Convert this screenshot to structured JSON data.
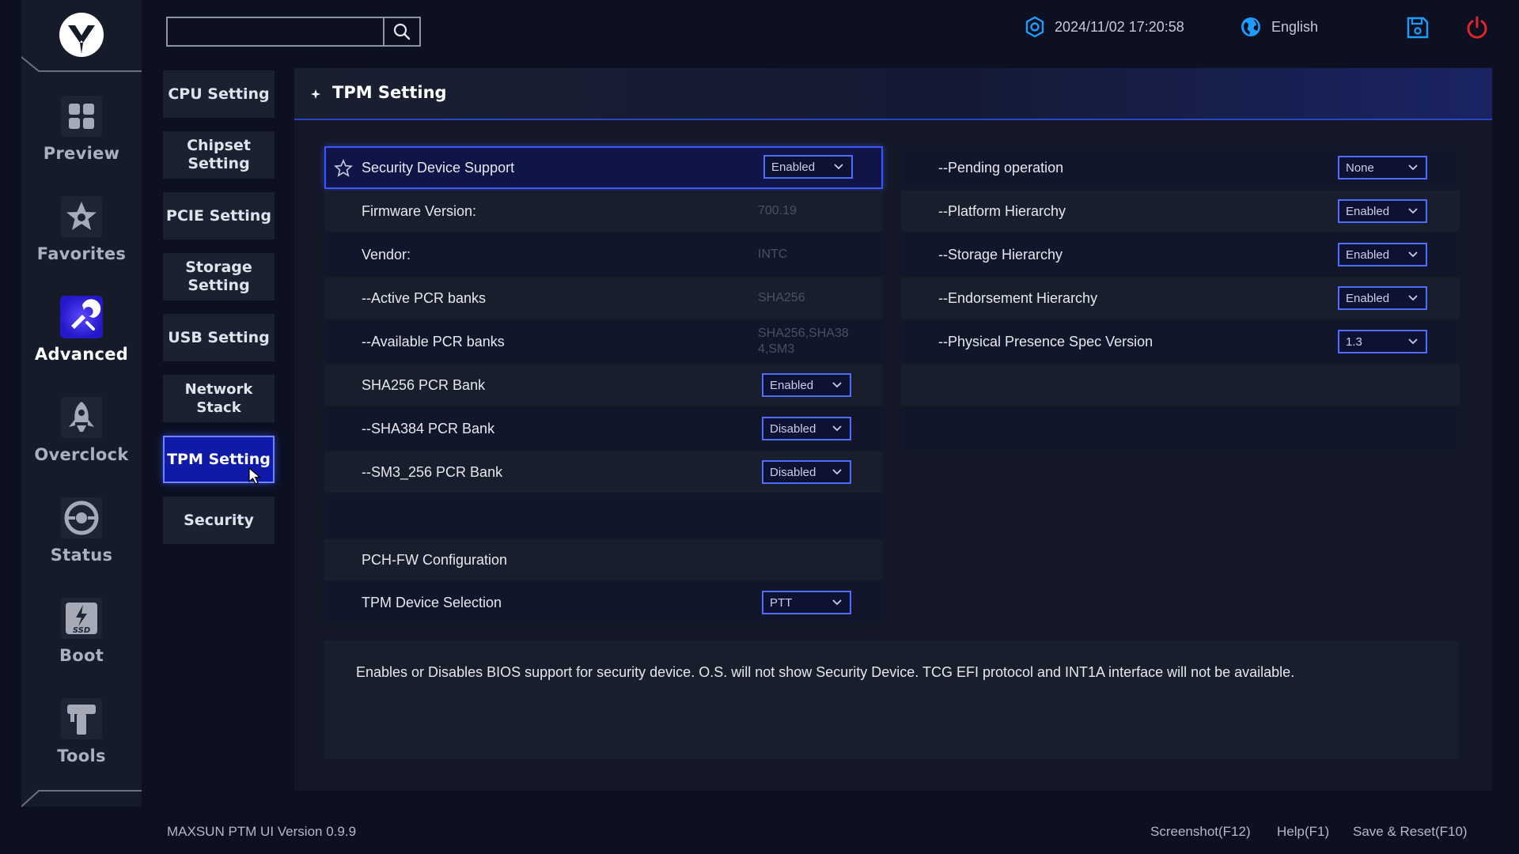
{
  "topbar": {
    "search_placeholder": "",
    "datetime": "2024/11/02 17:20:58",
    "language": "English"
  },
  "mainnav": [
    {
      "label": "Preview",
      "icon": "grid-icon"
    },
    {
      "label": "Favorites",
      "icon": "star-icon"
    },
    {
      "label": "Advanced",
      "icon": "advanced-icon",
      "active": true
    },
    {
      "label": "Overclock",
      "icon": "rocket-icon"
    },
    {
      "label": "Status",
      "icon": "status-icon"
    },
    {
      "label": "Boot",
      "icon": "ssd-icon"
    },
    {
      "label": "Tools",
      "icon": "tools-icon"
    }
  ],
  "subnav": [
    {
      "label": "CPU Setting"
    },
    {
      "label": "Chipset Setting"
    },
    {
      "label": "PCIE Setting"
    },
    {
      "label": "Storage Setting"
    },
    {
      "label": "USB Setting"
    },
    {
      "label": "Network Stack"
    },
    {
      "label": "TPM Setting",
      "active": true
    },
    {
      "label": "Security"
    }
  ],
  "panel": {
    "title": "TPM Setting",
    "left_rows": [
      {
        "label": "Security Device Support",
        "dropdown": "Enabled"
      },
      {
        "label": "Firmware Version:",
        "value": "700.19"
      },
      {
        "label": "Vendor:",
        "value": "INTC"
      },
      {
        "label": "--Active PCR banks",
        "value": "SHA256"
      },
      {
        "label": "--Available PCR banks",
        "value": "SHA256,SHA384,SM3"
      },
      {
        "label": "SHA256 PCR Bank",
        "dropdown": "Enabled"
      },
      {
        "label": "--SHA384 PCR Bank",
        "dropdown": "Disabled"
      },
      {
        "label": "--SM3_256 PCR Bank",
        "dropdown": "Disabled"
      },
      {
        "label": "PCH-FW Configuration"
      },
      {
        "label": "TPM Device Selection",
        "dropdown": "PTT"
      }
    ],
    "right_rows": [
      {
        "label": "--Pending operation",
        "dropdown": "None"
      },
      {
        "label": "--Platform Hierarchy",
        "dropdown": "Enabled"
      },
      {
        "label": "--Storage Hierarchy",
        "dropdown": "Enabled"
      },
      {
        "label": "--Endorsement Hierarchy",
        "dropdown": "Enabled"
      },
      {
        "label": "--Physical Presence Spec Version",
        "dropdown": "1.3"
      }
    ],
    "help_text": "Enables or Disables BIOS support for security device. O.S. will not show Security Device. TCG EFI protocol and INT1A interface will not be available."
  },
  "footer": {
    "version": "MAXSUN PTM UI Version 0.9.9",
    "screenshot": "Screenshot(F12)",
    "help": "Help(F1)",
    "save_reset": "Save & Reset(F10)"
  },
  "colors": {
    "accent": "#3a56ff",
    "active_subnav": "#0f1aa8",
    "power": "#e0262a",
    "info_icon": "#1e9bff"
  }
}
